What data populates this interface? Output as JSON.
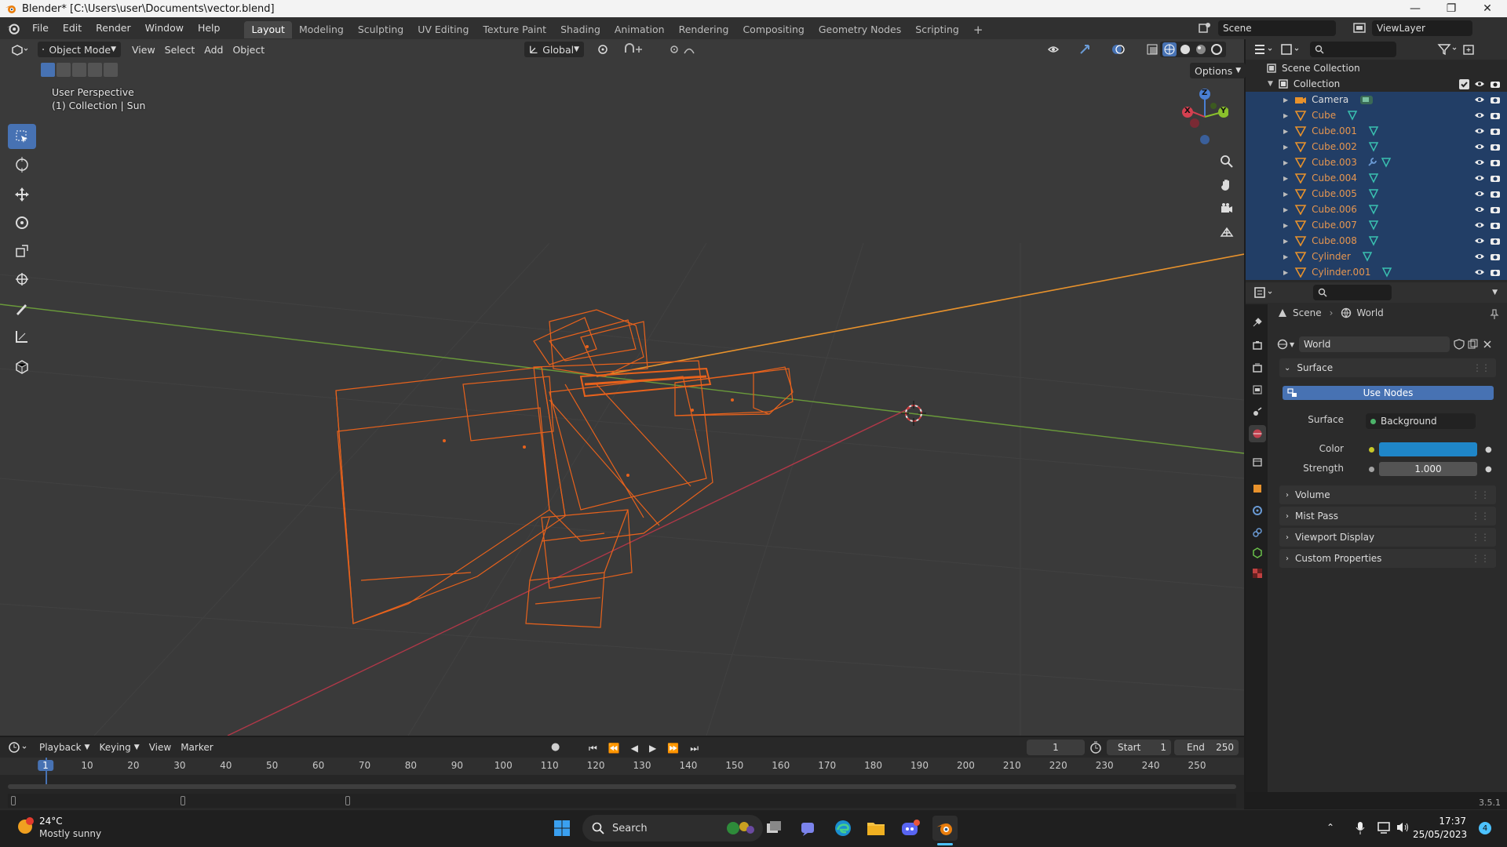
{
  "window": {
    "title": "Blender* [C:\\Users\\user\\Documents\\vector.blend]"
  },
  "menus": [
    "File",
    "Edit",
    "Render",
    "Window",
    "Help"
  ],
  "workspaces": {
    "tabs": [
      "Layout",
      "Modeling",
      "Sculpting",
      "UV Editing",
      "Texture Paint",
      "Shading",
      "Animation",
      "Rendering",
      "Compositing",
      "Geometry Nodes",
      "Scripting"
    ],
    "active": "Layout",
    "add": "+"
  },
  "scene_field": "Scene",
  "viewlayer_field": "ViewLayer",
  "viewport": {
    "mode": "Object Mode",
    "menus": [
      "View",
      "Select",
      "Add",
      "Object"
    ],
    "orientation": "Global",
    "options_label": "Options",
    "overlay_line1": "User Perspective",
    "overlay_line2": "(1) Collection | Sun",
    "gizmo": {
      "x": "X",
      "y": "Y",
      "z": "Z"
    },
    "colors": {
      "bg": "#3a3a3a",
      "wire_selected": "#e8621c",
      "axis_x": "#c04050",
      "axis_y": "#6a9a3a"
    }
  },
  "outliner": {
    "root": "Scene Collection",
    "collection": "Collection",
    "items": [
      "Camera",
      "Cube",
      "Cube.001",
      "Cube.002",
      "Cube.003",
      "Cube.004",
      "Cube.005",
      "Cube.006",
      "Cube.007",
      "Cube.008",
      "Cylinder",
      "Cylinder.001"
    ]
  },
  "properties": {
    "breadcrumb_scene": "Scene",
    "breadcrumb_world": "World",
    "world_name": "World",
    "surface_panel": "Surface",
    "use_nodes": "Use Nodes",
    "surface_label": "Surface",
    "surface_value": "Background",
    "color_label": "Color",
    "color_value": "#1f86c8",
    "strength_label": "Strength",
    "strength_value": "1.000",
    "panels": [
      "Volume",
      "Mist Pass",
      "Viewport Display",
      "Custom Properties"
    ]
  },
  "timeline": {
    "menus": [
      "Playback",
      "Keying",
      "View",
      "Marker"
    ],
    "current_frame": "1",
    "start_label": "Start",
    "start_value": "1",
    "end_label": "End",
    "end_value": "250",
    "ticks": [
      "1",
      "10",
      "20",
      "30",
      "40",
      "50",
      "60",
      "70",
      "80",
      "90",
      "100",
      "110",
      "120",
      "130",
      "140",
      "150",
      "160",
      "170",
      "180",
      "190",
      "200",
      "210",
      "220",
      "230",
      "240",
      "250"
    ]
  },
  "version": "3.5.1",
  "taskbar": {
    "weather_temp": "24°C",
    "weather_desc": "Mostly sunny",
    "search": "Search",
    "time": "17:37",
    "date": "25/05/2023",
    "notif_count": "4"
  }
}
